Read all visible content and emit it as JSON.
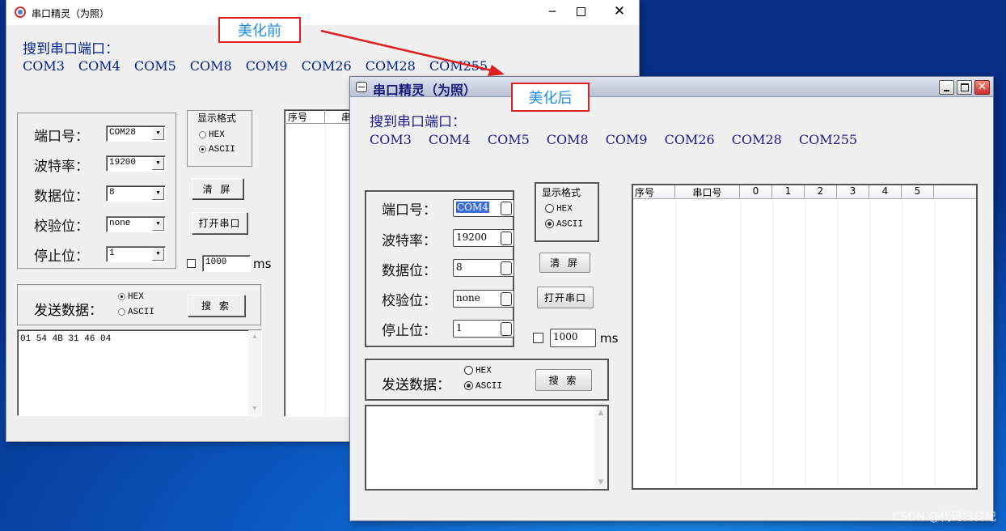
{
  "colors": {
    "accent_red": "#e02020",
    "label_blue": "#1f8de0",
    "old_text": "#00238c",
    "new_text": "#1a1a8c",
    "titlebar_new": "#c8d0e0"
  },
  "win1": {
    "title": "串口精灵（为照）",
    "found_label": "搜到串口端口：",
    "ports": [
      "COM3",
      "COM4",
      "COM5",
      "COM8",
      "COM9",
      "COM26",
      "COM28",
      "COM255"
    ],
    "fields": [
      {
        "label": "端口号：",
        "value": "COM28"
      },
      {
        "label": "波特率：",
        "value": "19200"
      },
      {
        "label": "数据位：",
        "value": "8"
      },
      {
        "label": "校验位：",
        "value": "none"
      },
      {
        "label": "停止位：",
        "value": "1"
      }
    ],
    "display_group": "显示格式",
    "hex": "HEX",
    "ascii": "ASCII",
    "clear_btn": "清 屏",
    "open_btn": "打开串口",
    "interval_value": "1000",
    "ms": "ms",
    "send_label": "发送数据：",
    "search_btn": "搜 索",
    "send_text": "01 54 4B 31 46 04",
    "table_cols": [
      "序号",
      "串"
    ]
  },
  "win2": {
    "title": "串口精灵（为照）",
    "found_label": "搜到串口端口：",
    "ports": [
      "COM3",
      "COM4",
      "COM5",
      "COM8",
      "COM9",
      "COM26",
      "COM28",
      "COM255"
    ],
    "fields": [
      {
        "label": "端口号：",
        "value": "COM4"
      },
      {
        "label": "波特率：",
        "value": "19200"
      },
      {
        "label": "数据位：",
        "value": "8"
      },
      {
        "label": "校验位：",
        "value": "none"
      },
      {
        "label": "停止位：",
        "value": "1"
      }
    ],
    "display_group": "显示格式",
    "hex": "HEX",
    "ascii": "ASCII",
    "clear_btn": "清 屏",
    "open_btn": "打开串口",
    "interval_value": "1000",
    "ms": "ms",
    "send_label": "发送数据：",
    "search_btn": "搜 索",
    "table_cols": [
      "序号",
      "串口号",
      "0",
      "1",
      "2",
      "3",
      "4",
      "5"
    ]
  },
  "annotations": {
    "before": "美化前",
    "after": "美化后"
  },
  "watermark": "CSDN @代码日日记"
}
